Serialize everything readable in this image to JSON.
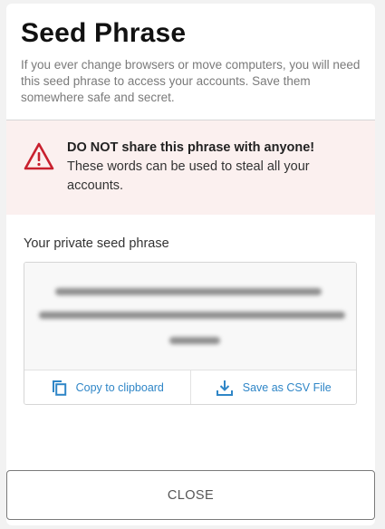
{
  "modal": {
    "title": "Seed Phrase",
    "subtitle": "If you ever change browsers or move computers, you will need this seed phrase to access your accounts. Save them somewhere safe and secret."
  },
  "warning": {
    "icon": "warning-triangle-icon",
    "headline": "DO NOT share this phrase with anyone!",
    "text": "These words can be used to steal all your accounts.",
    "color": "#c8202e"
  },
  "seed": {
    "label": "Your private seed phrase",
    "blurred": true
  },
  "actions": {
    "copy_label": "Copy to clipboard",
    "copy_icon": "copy-icon",
    "save_label": "Save as CSV File",
    "save_icon": "download-icon",
    "accent": "#2f86c7"
  },
  "footer": {
    "close_label": "CLOSE"
  }
}
